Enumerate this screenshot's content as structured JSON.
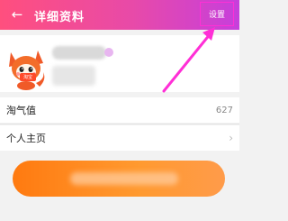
{
  "header": {
    "title": "详细资料",
    "back_icon": "←",
    "settings_label": "设置",
    "gradient_start": "#ff4f7e",
    "gradient_end": "#c63fdc"
  },
  "profile": {
    "avatar_icon": "fox-avatar-icon",
    "badge_label": "淘宝"
  },
  "rows": [
    {
      "label": "淘气值",
      "value": "627"
    },
    {
      "label": "个人主页",
      "chevron": "›"
    }
  ],
  "action_button": {
    "color": "#ff8a20"
  },
  "annotation": {
    "arrow_color": "#ff2fd6"
  }
}
